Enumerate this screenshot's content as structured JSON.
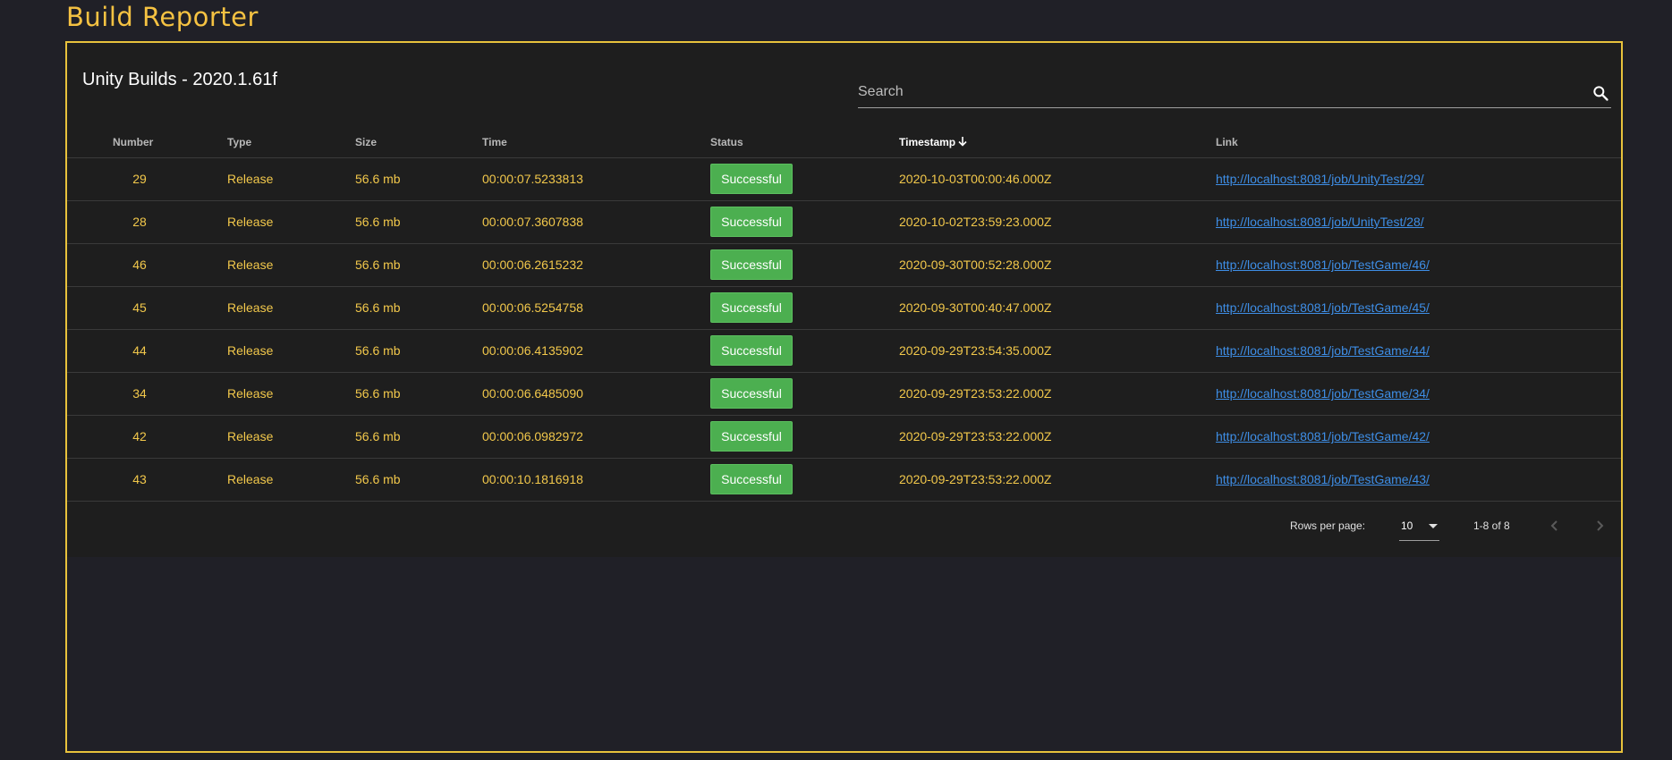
{
  "app": {
    "title": "Build Reporter"
  },
  "card": {
    "title": "Unity Builds - 2020.1.61f",
    "search": {
      "placeholder": "Search",
      "value": ""
    }
  },
  "table": {
    "columns": {
      "number": "Number",
      "type": "Type",
      "size": "Size",
      "time": "Time",
      "status": "Status",
      "timestamp": "Timestamp",
      "link": "Link"
    },
    "sorted_by": "timestamp",
    "sort_direction": "descending",
    "rows": [
      {
        "number": "29",
        "type": "Release",
        "size": "56.6 mb",
        "time": "00:00:07.5233813",
        "status": "Successful",
        "timestamp": "2020-10-03T00:00:46.000Z",
        "link": "http://localhost:8081/job/UnityTest/29/"
      },
      {
        "number": "28",
        "type": "Release",
        "size": "56.6 mb",
        "time": "00:00:07.3607838",
        "status": "Successful",
        "timestamp": "2020-10-02T23:59:23.000Z",
        "link": "http://localhost:8081/job/UnityTest/28/"
      },
      {
        "number": "46",
        "type": "Release",
        "size": "56.6 mb",
        "time": "00:00:06.2615232",
        "status": "Successful",
        "timestamp": "2020-09-30T00:52:28.000Z",
        "link": "http://localhost:8081/job/TestGame/46/"
      },
      {
        "number": "45",
        "type": "Release",
        "size": "56.6 mb",
        "time": "00:00:06.5254758",
        "status": "Successful",
        "timestamp": "2020-09-30T00:40:47.000Z",
        "link": "http://localhost:8081/job/TestGame/45/"
      },
      {
        "number": "44",
        "type": "Release",
        "size": "56.6 mb",
        "time": "00:00:06.4135902",
        "status": "Successful",
        "timestamp": "2020-09-29T23:54:35.000Z",
        "link": "http://localhost:8081/job/TestGame/44/"
      },
      {
        "number": "34",
        "type": "Release",
        "size": "56.6 mb",
        "time": "00:00:06.6485090",
        "status": "Successful",
        "timestamp": "2020-09-29T23:53:22.000Z",
        "link": "http://localhost:8081/job/TestGame/34/"
      },
      {
        "number": "42",
        "type": "Release",
        "size": "56.6 mb",
        "time": "00:00:06.0982972",
        "status": "Successful",
        "timestamp": "2020-09-29T23:53:22.000Z",
        "link": "http://localhost:8081/job/TestGame/42/"
      },
      {
        "number": "43",
        "type": "Release",
        "size": "56.6 mb",
        "time": "00:00:10.1816918",
        "status": "Successful",
        "timestamp": "2020-09-29T23:53:22.000Z",
        "link": "http://localhost:8081/job/TestGame/43/"
      }
    ]
  },
  "pagination": {
    "rows_per_page_label": "Rows per page:",
    "rows_per_page": "10",
    "range": "1-8 of 8"
  },
  "icons": {
    "search": "search-icon",
    "sort": "arrow-down-icon",
    "dropdown": "caret-down-icon",
    "prev": "chevron-left-icon",
    "next": "chevron-right-icon"
  },
  "colors": {
    "background": "#202027",
    "accent": "#f5c242",
    "card": "#1e1e1e",
    "success": "#4caf50",
    "link": "#3e8ee6"
  }
}
